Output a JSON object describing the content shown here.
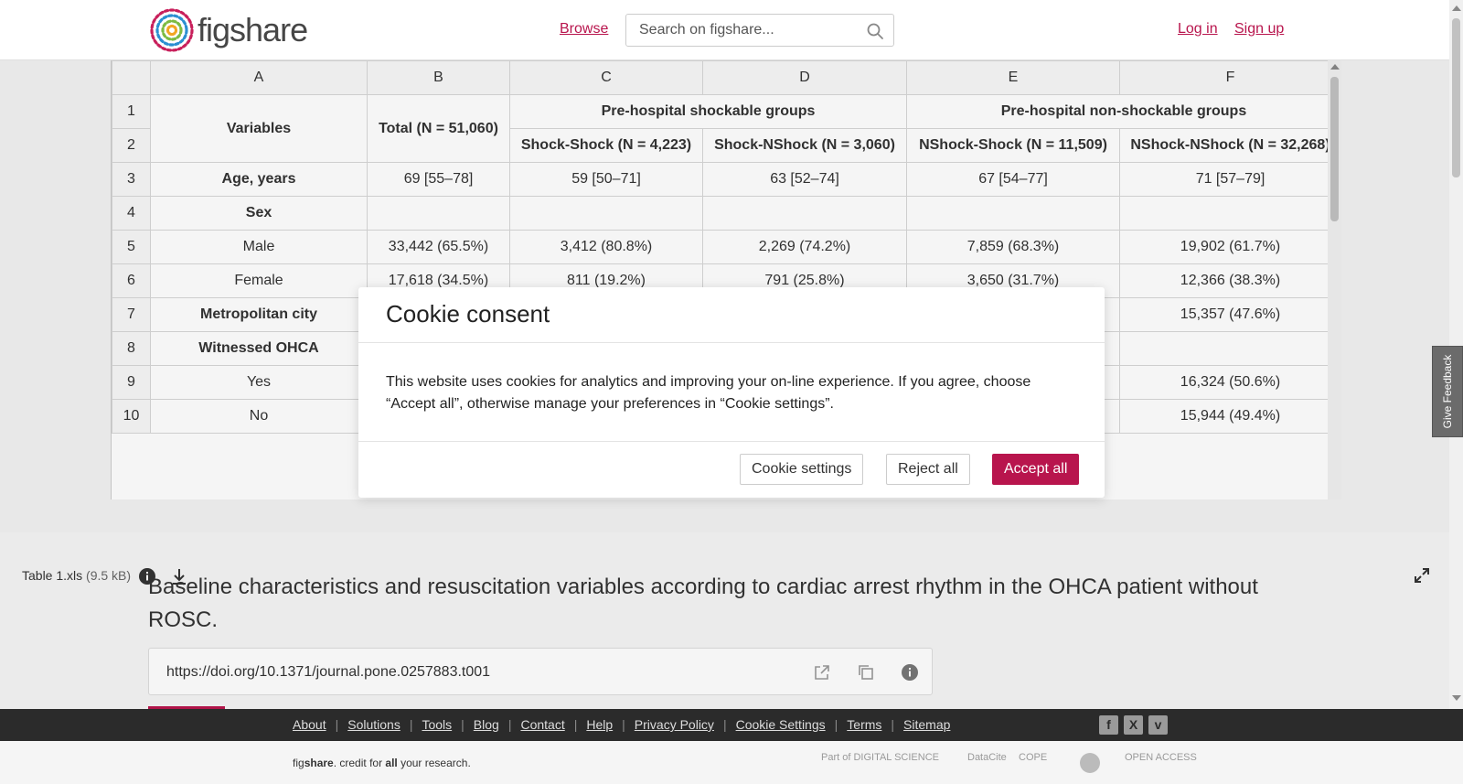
{
  "header": {
    "logo_prefix": "fig",
    "logo_suffix": "share",
    "browse_label": "Browse",
    "search_placeholder": "Search on figshare...",
    "login_label": "Log in",
    "signup_label": "Sign up"
  },
  "sheet": {
    "columns": [
      "A",
      "B",
      "C",
      "D",
      "E",
      "F"
    ],
    "rownums": [
      "1",
      "2",
      "3",
      "4",
      "5",
      "6",
      "7",
      "8",
      "9",
      "10"
    ],
    "variables_header": "Variables",
    "total_header": "Total (N = 51,060)",
    "group1_header": "Pre-hospital shockable groups",
    "group2_header": "Pre-hospital non-shockable groups",
    "sub_c": "Shock-Shock (N = 4,223)",
    "sub_d": "Shock-NShock (N = 3,060)",
    "sub_e": "NShock-Shock (N = 11,509)",
    "sub_f": "NShock-NShock (N = 32,268)",
    "rows": [
      {
        "label": "Age, years",
        "bold": true,
        "b": "69 [55–78]",
        "c": "59 [50–71]",
        "d": "63 [52–74]",
        "e": "67 [54–77]",
        "f": "71 [57–79]"
      },
      {
        "label": "Sex",
        "bold": true,
        "b": "",
        "c": "",
        "d": "",
        "e": "",
        "f": ""
      },
      {
        "label": "Male",
        "bold": false,
        "b": "33,442 (65.5%)",
        "c": "3,412 (80.8%)",
        "d": "2,269 (74.2%)",
        "e": "7,859 (68.3%)",
        "f": "19,902 (61.7%)"
      },
      {
        "label": "Female",
        "bold": false,
        "b": "17,618 (34.5%)",
        "c": "811 (19.2%)",
        "d": "791 (25.8%)",
        "e": "3,650 (31.7%)",
        "f": "12,366 (38.3%)"
      },
      {
        "label": "Metropolitan city",
        "bold": true,
        "b": "",
        "c": "",
        "d": "",
        "e": "",
        "f": "15,357 (47.6%)"
      },
      {
        "label": "Witnessed OHCA",
        "bold": true,
        "b": "",
        "c": "",
        "d": "",
        "e": "",
        "f": ""
      },
      {
        "label": "Yes",
        "bold": false,
        "b": "",
        "c": "",
        "d": "",
        "e": "",
        "f": "16,324 (50.6%)"
      },
      {
        "label": "No",
        "bold": false,
        "b": "",
        "c": "",
        "d": "",
        "e": "",
        "f": "15,944 (49.4%)"
      }
    ]
  },
  "file": {
    "name": "Table 1.xls",
    "size": "(9.5 kB)"
  },
  "article": {
    "title": "Baseline characteristics and resuscitation variables according to cardiac arrest rhythm in the OHCA patient without ROSC.",
    "doi": "https://doi.org/10.1371/journal.pone.0257883.t001"
  },
  "feedback_label": "Give Feedback",
  "footer": {
    "links": [
      "About",
      "Solutions",
      "Tools",
      "Blog",
      "Contact",
      "Help",
      "Privacy Policy",
      "Cookie Settings",
      "Terms",
      "Sitemap"
    ],
    "tagline_pre": "fig",
    "tagline_brand": "share",
    "tagline_mid": ". credit for ",
    "tagline_all": "all",
    "tagline_post": " your research.",
    "partners": [
      "Part of DIGITAL SCIENCE",
      "DataCite",
      "COPE",
      "",
      "OPEN ACCESS"
    ]
  },
  "cookie": {
    "title": "Cookie consent",
    "body": "This website uses cookies for analytics and improving your on-line experience. If you agree, choose “Accept all”, otherwise manage your preferences in “Cookie settings”.",
    "settings_label": "Cookie settings",
    "reject_label": "Reject all",
    "accept_label": "Accept all"
  },
  "colors": {
    "brand": "#b8154d"
  }
}
